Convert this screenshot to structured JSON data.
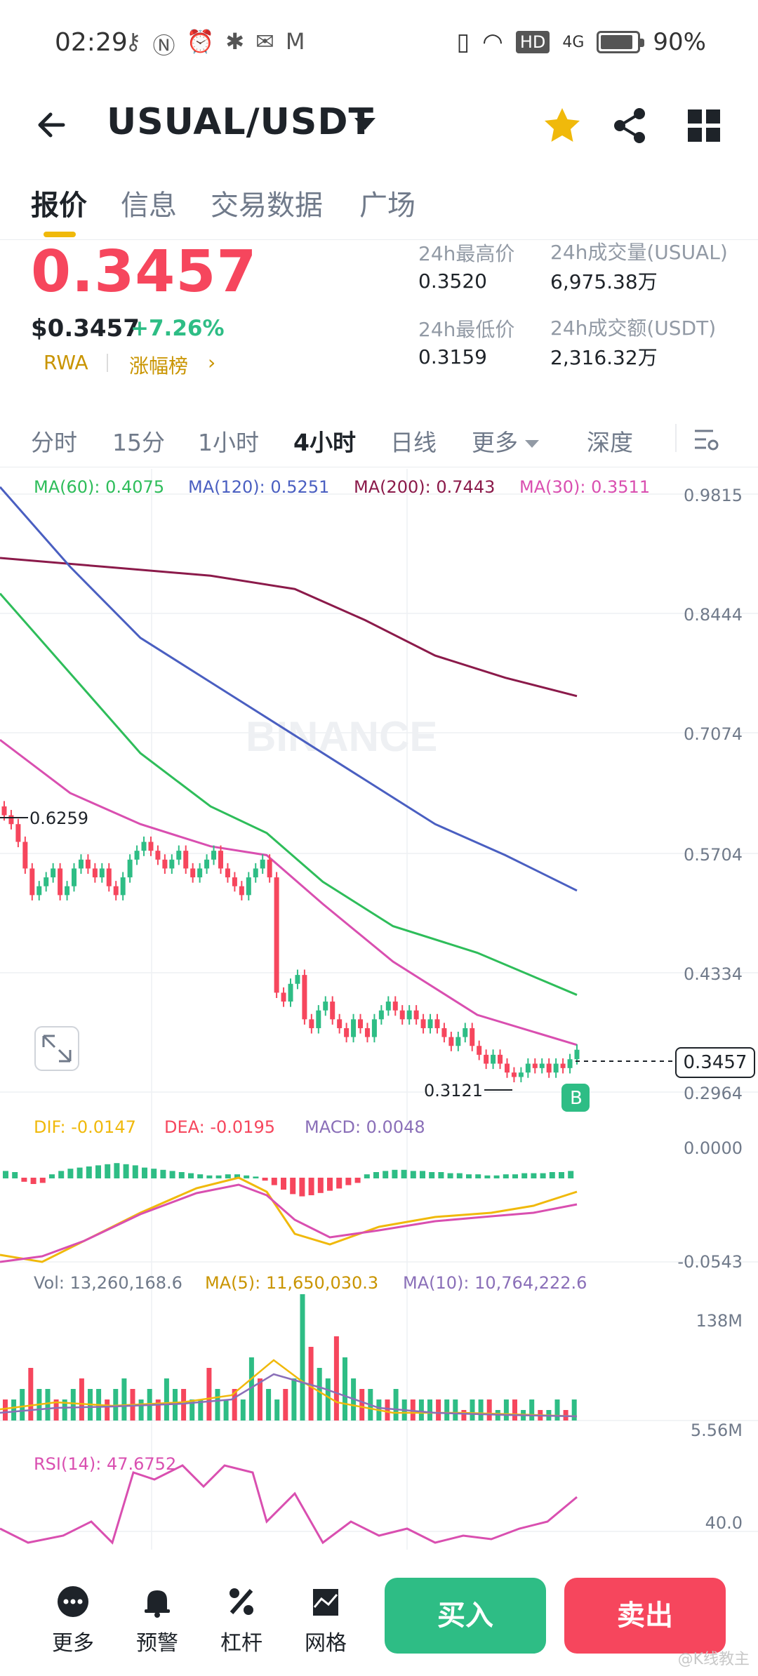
{
  "status_bar": {
    "time": "02:29",
    "network": "HD",
    "signal": "4G",
    "battery": "90%",
    "battery_level": 0.9
  },
  "header": {
    "pair": "USUAL/USDT",
    "icons": [
      "back-arrow-icon",
      "chevron-down-icon",
      "star-icon",
      "share-icon",
      "grid-icon"
    ],
    "accent": "#f0b90b"
  },
  "tabs": [
    {
      "label": "报价",
      "active": true
    },
    {
      "label": "信息",
      "active": false
    },
    {
      "label": "交易数据",
      "active": false
    },
    {
      "label": "广场",
      "active": false
    }
  ],
  "ticker": {
    "price": "0.3457",
    "price_usd": "$0.3457",
    "change": "+7.26%",
    "tag_1": "RWA",
    "tag_2": "涨幅榜",
    "high_label": "24h最高价",
    "high_value": "0.3520",
    "low_label": "24h最低价",
    "low_value": "0.3159",
    "vol_label": "24h成交量(USUAL)",
    "vol_value": "6,975.38万",
    "turnover_label": "24h成交额(USDT)",
    "turnover_value": "2,316.32万",
    "down_color": "#f6465d",
    "up_color": "#2ebd85"
  },
  "intervals": [
    {
      "label": "分时",
      "active": false
    },
    {
      "label": "15分",
      "active": false
    },
    {
      "label": "1小时",
      "active": false
    },
    {
      "label": "4小时",
      "active": true
    },
    {
      "label": "日线",
      "active": false
    },
    {
      "label": "更多",
      "active": false
    },
    {
      "label": "深度",
      "active": false
    }
  ],
  "chart": {
    "watermark": "BINANCE",
    "ma60": "MA(60): 0.4075",
    "ma120": "MA(120): 0.5251",
    "ma200": "MA(200): 0.7443",
    "ma30": "MA(30): 0.3511",
    "price_axis": [
      "0.9815",
      "0.8444",
      "0.7074",
      "0.5704",
      "0.4334",
      "0.2964"
    ],
    "current_price": "0.3457",
    "high_marker": "0.6259",
    "low_marker": "0.3121",
    "b_marker": "B",
    "dif": "DIF: -0.0147",
    "dea": "DEA: -0.0195",
    "macd": "MACD: 0.0048",
    "macd_axis_top": "0.0000",
    "macd_axis_bottom": "-0.0543",
    "vol": "Vol: 13,260,168.6",
    "vol_ma5": "MA(5): 11,650,030.3",
    "vol_ma10": "MA(10): 10,764,222.6",
    "vol_axis_top": "138M",
    "vol_axis_bottom": "5.56M",
    "rsi": "RSI(14): 47.6752",
    "rsi_axis": "40.0"
  },
  "chart_data": {
    "type": "candlestick",
    "interval": "4小时",
    "ylim": [
      0.2964,
      0.9815
    ],
    "closes": [
      0.61,
      0.6,
      0.58,
      0.55,
      0.52,
      0.53,
      0.54,
      0.55,
      0.52,
      0.53,
      0.55,
      0.56,
      0.55,
      0.54,
      0.55,
      0.53,
      0.52,
      0.54,
      0.56,
      0.57,
      0.58,
      0.57,
      0.56,
      0.55,
      0.56,
      0.57,
      0.55,
      0.54,
      0.55,
      0.56,
      0.57,
      0.55,
      0.54,
      0.53,
      0.52,
      0.54,
      0.55,
      0.56,
      0.54,
      0.41,
      0.4,
      0.42,
      0.43,
      0.38,
      0.37,
      0.39,
      0.4,
      0.38,
      0.37,
      0.36,
      0.38,
      0.37,
      0.36,
      0.38,
      0.39,
      0.4,
      0.39,
      0.38,
      0.39,
      0.38,
      0.37,
      0.38,
      0.37,
      0.36,
      0.35,
      0.36,
      0.37,
      0.35,
      0.34,
      0.33,
      0.34,
      0.33,
      0.32,
      0.315,
      0.32,
      0.33,
      0.325,
      0.33,
      0.32,
      0.33,
      0.325,
      0.335,
      0.3457
    ],
    "series": [
      {
        "name": "MA(60)",
        "last": 0.4075,
        "color": "#2ebd5a"
      },
      {
        "name": "MA(120)",
        "last": 0.5251,
        "color": "#4a5fc1"
      },
      {
        "name": "MA(200)",
        "last": 0.7443,
        "color": "#8b1a4a"
      },
      {
        "name": "MA(30)",
        "last": 0.3511,
        "color": "#d94fb0"
      }
    ]
  },
  "bottom_bar": {
    "more": "更多",
    "alert": "预警",
    "leverage": "杠杆",
    "grid": "网格",
    "buy": "买入",
    "sell": "卖出",
    "watermark": "@K线教主"
  }
}
